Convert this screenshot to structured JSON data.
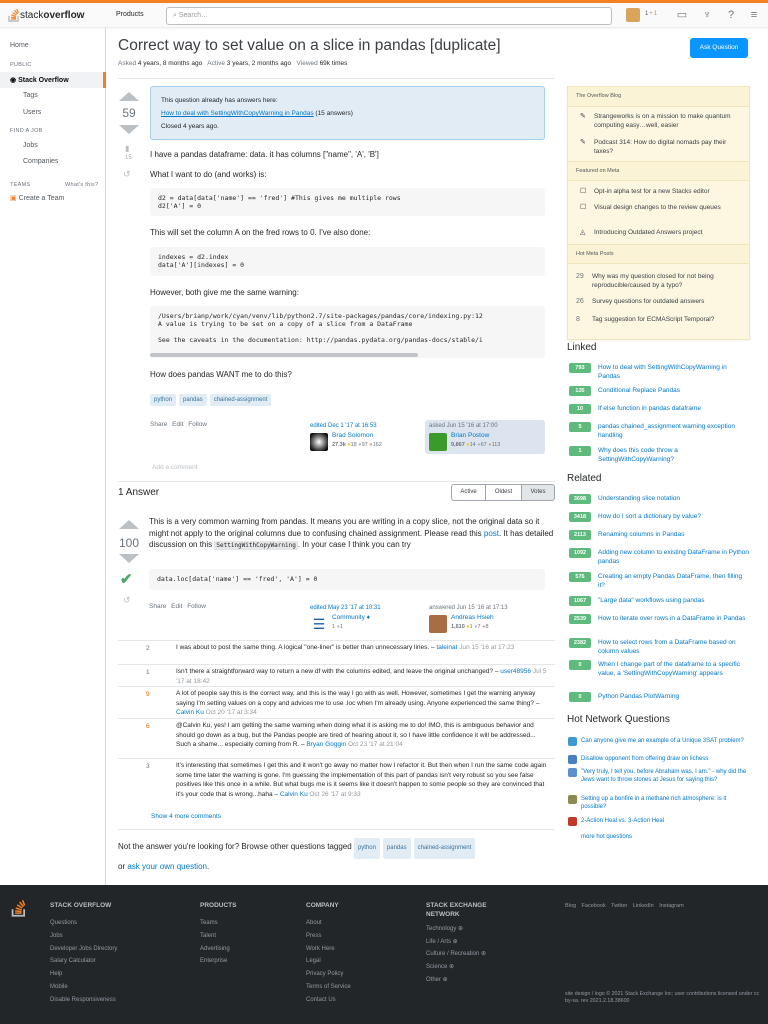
{
  "header": {
    "logo_text_plain": "stack",
    "logo_text_bold": "overflow",
    "products": "Products",
    "search_placeholder": "Search…",
    "rep": "1",
    "badge": "• 1"
  },
  "sidebar": {
    "home": "Home",
    "public": "PUBLIC",
    "stack_overflow": "Stack Overflow",
    "tags": "Tags",
    "users": "Users",
    "find_a_job": "FIND A JOB",
    "jobs": "Jobs",
    "companies": "Companies",
    "teams": "TEAMS",
    "whats_this": "What's this?",
    "create_team": "Create a Team"
  },
  "question": {
    "title": "Correct way to set value on a slice in pandas [duplicate]",
    "asked_label": "Asked",
    "asked": "4 years, 8 months ago",
    "active_label": "Active",
    "active": "3 years, 2 months ago",
    "viewed_label": "Viewed",
    "viewed": "69k times",
    "ask_button": "Ask Question",
    "votes": "59",
    "bookmarks": "15",
    "notice": {
      "line1": "This question already has answers here:",
      "link": "How to deal with SettingWithCopyWarning in Pandas",
      "count": "(15 answers)",
      "closed": "Closed 4 years ago."
    },
    "p1": "I have a pandas dataframe: data. it has columns [\"name\", 'A', 'B']",
    "p2": "What I want to do (and works) is:",
    "code1": "d2 = data[data['name'] == 'fred'] #This gives me multiple rows\nd2['A'] = 0",
    "p3": "This will set the column A on the fred rows to 0. I've also done:",
    "code2": "indexes = d2.index\ndata['A'][indexes] = 0",
    "p4": "However, both give me the same warning:",
    "code3": "/Users/brianp/work/cyan/venv/lib/python2.7/site-packages/pandas/core/indexing.py:12\nA value is trying to be set on a copy of a slice from a DataFrame\n\nSee the caveats in the documentation: http://pandas.pydata.org/pandas-docs/stable/i",
    "p5": "How does pandas WANT me to do this?",
    "tags": [
      "python",
      "pandas",
      "chained-assignment"
    ],
    "actions": [
      "Share",
      "Edit",
      "Follow"
    ],
    "edited": {
      "when": "edited Dec 1 '17 at 16:53",
      "name": "Brad Solomon",
      "rep": "27.3k",
      "gold": "18",
      "silver": "97",
      "bronze": "162"
    },
    "asked_card": {
      "when": "asked Jun 15 '16 at 17:00",
      "name": "Brian Postow",
      "rep": "9,867",
      "gold": "14",
      "silver": "67",
      "bronze": "113"
    },
    "add_comment": "Add a comment"
  },
  "answers": {
    "count_label": "1 Answer",
    "sort": [
      "Active",
      "Oldest",
      "Votes"
    ],
    "votes": "100",
    "text_a": "This is a very common warning from pandas. It means you are writing in a copy slice, not the original data so it might not apply to the original columns due to confusing chained assignment. Please read this ",
    "link": "post",
    "text_b": ". It has detailed discussion on this ",
    "inline_code": "SettingWithCopyWarning",
    "text_c": ". In your case I think you can try",
    "code": "data.loc[data['name'] == 'fred', 'A'] = 0",
    "actions": [
      "Share",
      "Edit",
      "Follow"
    ],
    "edited": {
      "when": "edited May 23 '17 at 10:31",
      "name": "Community",
      "rep": "1",
      "silver": "1"
    },
    "answered": {
      "when": "answered Jun 15 '16 at 17:13",
      "name": "Andreas Hsieh",
      "rep": "1,610",
      "gold": "1",
      "silver": "7",
      "bronze": "8"
    },
    "comments": [
      {
        "score": "2",
        "text": "I was about to post the same thing. A logical \"one-liner\" is better than unnecessary lines.",
        "author": "taleinat",
        "date": "Jun 15 '16 at 17:23"
      },
      {
        "score": "1",
        "text": "Isn't there a straightforward way to return a new df with the columns edited, and leave the original unchanged?",
        "author": "user48956",
        "date": "Jul 5 '17 at 18:42"
      },
      {
        "score": "9",
        "text": "A lot of people say this is the correct way, and this is the way I go with as well. However, sometimes I get the warning anyway saying I'm setting values on a copy and advices me to use .loc when I'm already using. Anyone experienced the same thing?",
        "author": "Calvin Ku",
        "date": "Oct 20 '17 at 3:34"
      },
      {
        "score": "6",
        "text": "@Calvin Ku, yes! I am getting the same warning when doing what it is asking me to do! IMO, this is ambiguous behavior and should go down as a bug, but the Pandas people are tired of hearing about it, so I have little confidence it will be addressed... Such a shame... especially coming from R.",
        "author": "Bryan Goggin",
        "date": "Oct 23 '17 at 21:04"
      },
      {
        "score": "3",
        "text": "It's interesting that sometimes I get this and it won't go away no matter how I refactor it. But then when I run the same code again some time later the warning is gone. I'm guessing the implementation of this part of pandas isn't very robust so you see false positives like this once in a while. But what bugs me is it seems like it doesn't happen to some people so they are convinced that it's your code that is wrong...haha",
        "author": "Calvin Ku",
        "date": "Oct 26 '17 at 9:33"
      }
    ],
    "show_more": "Show 4 more comments"
  },
  "not_answer": {
    "text": "Not the answer you're looking for? Browse other questions tagged",
    "tags": [
      "python",
      "pandas",
      "chained-assignment"
    ],
    "or": "or",
    "ask_link": "ask your own question",
    "end": "."
  },
  "right": {
    "blog_title": "The Overflow Blog",
    "blog": [
      "Strangeworks is on a mission to make quantum computing easy…well, easier",
      "Podcast 314: How do digital nomads pay their taxes?"
    ],
    "meta_title": "Featured on Meta",
    "meta": [
      "Opt-in alpha test for a new Stacks editor",
      "Visual design changes to the review queues",
      "Introducing Outdated Answers project"
    ],
    "hot_meta_title": "Hot Meta Posts",
    "hot_meta": [
      {
        "n": "29",
        "t": "Why was my question closed for not being reproducible/caused by a typo?"
      },
      {
        "n": "26",
        "t": "Survey questions for outdated answers"
      },
      {
        "n": "8",
        "t": "Tag suggestion for ECMAScript Temporal?"
      }
    ],
    "linked_title": "Linked",
    "linked": [
      {
        "n": "793",
        "t": "How to deal with SettingWithCopyWarning in Pandas"
      },
      {
        "n": "135",
        "t": "Conditional Replace Pandas"
      },
      {
        "n": "10",
        "t": "If else function in pandas dataframe"
      },
      {
        "n": "5",
        "t": "pandas chained_assignment warning exception handling"
      },
      {
        "n": "1",
        "t": "Why does this code throw a SettingWithCopyWarning?"
      }
    ],
    "related_title": "Related",
    "related": [
      {
        "n": "3698",
        "t": "Understanding slice notation"
      },
      {
        "n": "3418",
        "t": "How do I sort a dictionary by value?"
      },
      {
        "n": "2113",
        "t": "Renaming columns in Pandas"
      },
      {
        "n": "1092",
        "t": "Adding new column to existing DataFrame in Python pandas"
      },
      {
        "n": "576",
        "t": "Creating an empty Pandas DataFrame, then filling it?"
      },
      {
        "n": "1067",
        "t": "\"Large data\" workflows using pandas"
      },
      {
        "n": "2539",
        "t": "How to iterate over rows in a DataFrame in Pandas"
      },
      {
        "n": "2382",
        "t": "How to select rows from a DataFrame based on column values"
      },
      {
        "n": "0",
        "t": "When I change part of the dataframe to a specific value, a 'SettingWithCopyWarning' appears"
      },
      {
        "n": "0",
        "t": "Python Pandas PlotWarning"
      }
    ],
    "hot_title": "Hot Network Questions",
    "hot": [
      {
        "t": "Can anyone give me an example of a Unique 3SAT problem?",
        "c": "#3d9ad0"
      },
      {
        "t": "Disallow opponent from offering draw on lichess",
        "c": "#4a7fbf"
      },
      {
        "t": "\"Very truly, I tell you, before Abraham was, I am.\" - why did the Jews want to throw stones at Jesus for saying this?",
        "c": "#5c8fd0"
      },
      {
        "t": "Setting up a bonfire in a methane rich atmosphere: is it possible?",
        "c": "#8a8a50"
      },
      {
        "t": "2-Action Heal vs. 3-Action Heal",
        "c": "#c0392b"
      }
    ],
    "more_hot": "more hot questions"
  },
  "footer": {
    "cols": [
      {
        "title": "STACK OVERFLOW",
        "links": [
          "Questions",
          "Jobs",
          "Developer Jobs Directory",
          "Salary Calculator",
          "Help",
          "Mobile",
          "Disable Responsiveness"
        ]
      },
      {
        "title": "PRODUCTS",
        "links": [
          "Teams",
          "Talent",
          "Advertising",
          "Enterprise"
        ]
      },
      {
        "title": "COMPANY",
        "links": [
          "About",
          "Press",
          "Work Here",
          "Legal",
          "Privacy Policy",
          "Terms of Service",
          "Contact Us"
        ]
      },
      {
        "title": "STACK EXCHANGE NETWORK",
        "links": [
          "Technology",
          "Life / Arts",
          "Culture / Recreation",
          "Science",
          "Other"
        ]
      }
    ],
    "social": [
      "Blog",
      "Facebook",
      "Twitter",
      "LinkedIn",
      "Instagram"
    ],
    "copyright": "site design / logo © 2021 Stack Exchange Inc; user contributions licensed under cc by-sa. rev 2021.2.18.38600"
  }
}
